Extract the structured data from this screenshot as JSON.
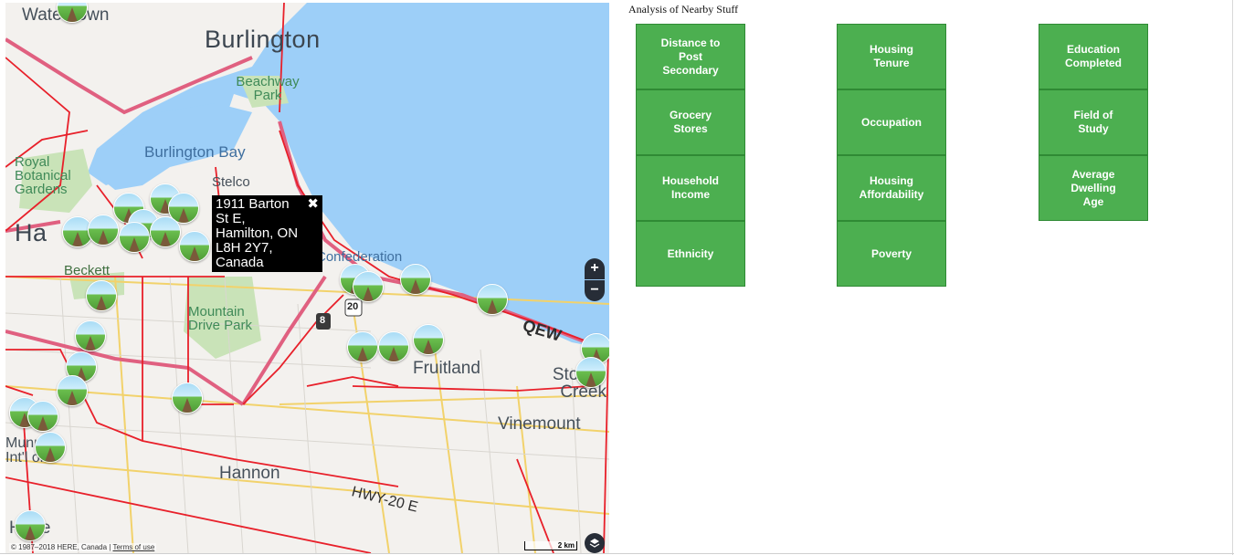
{
  "map": {
    "labels": {
      "waterdown": "Waterdown",
      "burlington": "Burlington",
      "beachway_park": "Beachway Park",
      "burlington_bay": "Burlington Bay",
      "royal_botanical": "Royal Botanical Gardens",
      "stelco": "Stelco",
      "hamilton": "Ha",
      "beckett": "Beckett",
      "confederation": "Confederation",
      "mountain_drive_park": "Mountain Drive Park",
      "qew": "QEW",
      "fruitland": "Fruitland",
      "stoney_creek": "Stoney Creek",
      "vinemount": "Vinemount",
      "munro": "Munr n Int'l ort",
      "hannon": "Hannon",
      "hwy20e": "HWY-20 E",
      "route8": "8",
      "route20": "20",
      "hope": "Hope"
    },
    "popup": {
      "address": "1911 Barton St E, Hamilton, ON L8H 2Y7, Canada",
      "close_glyph": "✖"
    },
    "controls": {
      "zoom_in": "+",
      "zoom_out": "−",
      "layers_icon": "layers-icon"
    },
    "attribution": {
      "text": "© 1987–2018 HERE, Canada | ",
      "terms": "Terms of use"
    },
    "scale": "2 km",
    "colors": {
      "water": "#9dcff8",
      "land": "#f3f1ee",
      "park": "#c9e3b8",
      "boundary": "#e8202a",
      "highway": "#e06080",
      "road": "#f2d26b"
    }
  },
  "panel": {
    "title": "Analysis of Nearby Stuff",
    "columns": [
      [
        "Distance to Post Secondary",
        "Grocery Stores",
        "Household Income",
        "Ethnicity"
      ],
      [
        "Housing Tenure",
        "Occupation",
        "Housing Affordability",
        "Poverty"
      ],
      [
        "Education Completed",
        "Field of Study",
        "Average Dwelling Age"
      ]
    ],
    "button_color": "#4caf50"
  }
}
